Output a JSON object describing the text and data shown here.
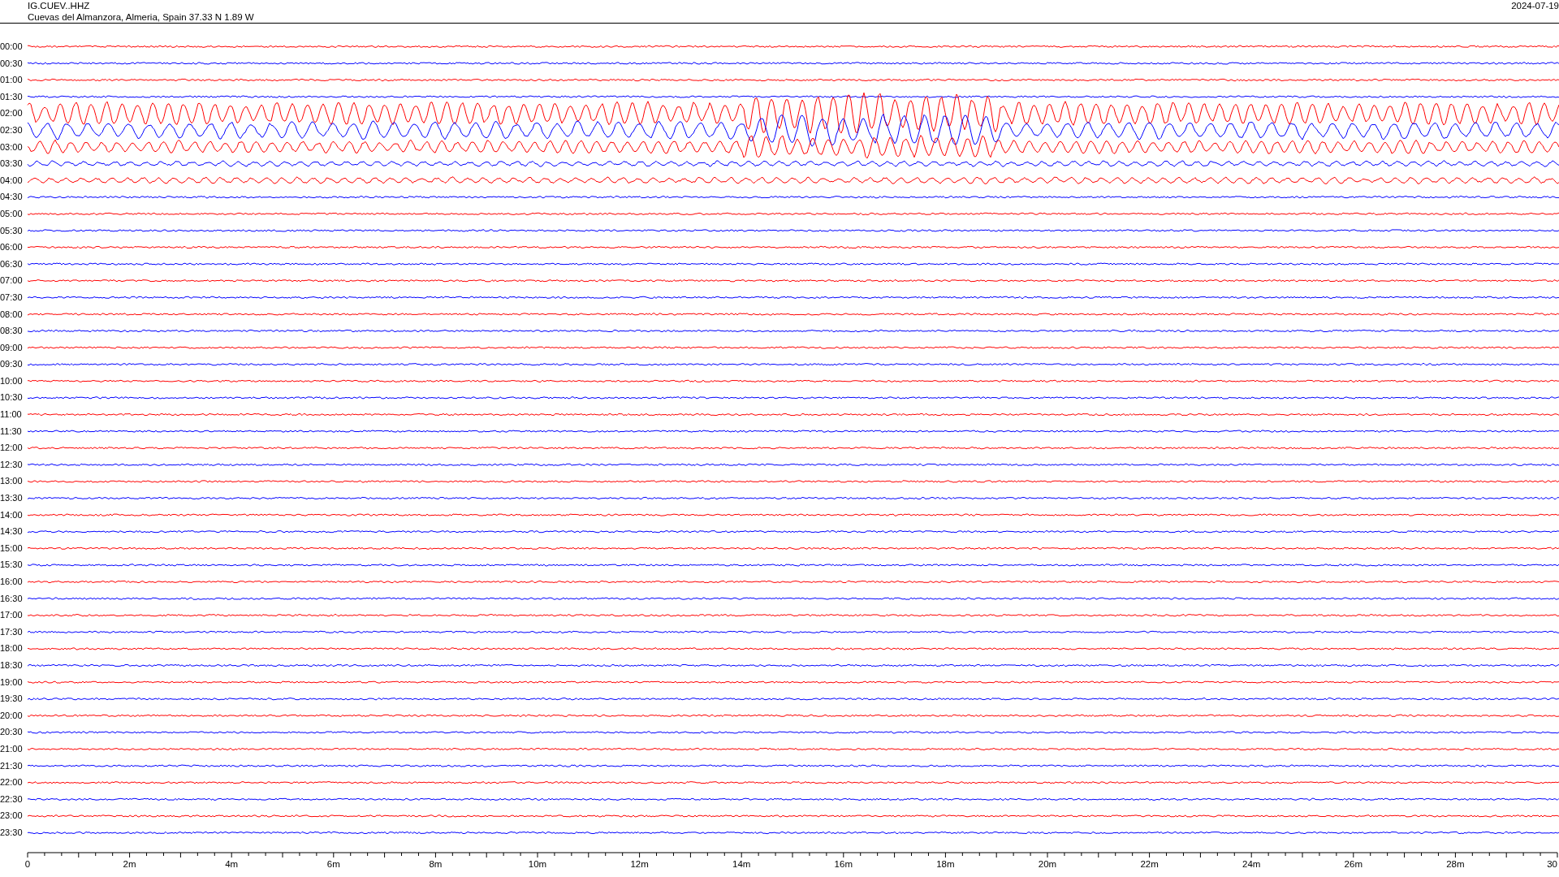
{
  "header": {
    "station": "IG.CUEV..HHZ",
    "location": "Cuevas del Almanzora, Almeria, Spain  37.33 N 1.89 W",
    "date": "2024-07-19"
  },
  "rows": [
    {
      "time": "00:00",
      "color": "#ff0000"
    },
    {
      "time": "00:30",
      "color": "#0000ff"
    },
    {
      "time": "01:00",
      "color": "#ff0000"
    },
    {
      "time": "01:30",
      "color": "#0000ff"
    },
    {
      "time": "02:00",
      "color": "#ff0000"
    },
    {
      "time": "02:30",
      "color": "#0000ff"
    },
    {
      "time": "03:00",
      "color": "#ff0000"
    },
    {
      "time": "03:30",
      "color": "#0000ff"
    },
    {
      "time": "04:00",
      "color": "#ff0000"
    },
    {
      "time": "04:30",
      "color": "#0000ff"
    },
    {
      "time": "05:00",
      "color": "#ff0000"
    },
    {
      "time": "05:30",
      "color": "#0000ff"
    },
    {
      "time": "06:00",
      "color": "#ff0000"
    },
    {
      "time": "06:30",
      "color": "#0000ff"
    },
    {
      "time": "07:00",
      "color": "#ff0000"
    },
    {
      "time": "07:30",
      "color": "#0000ff"
    },
    {
      "time": "08:00",
      "color": "#ff0000"
    },
    {
      "time": "08:30",
      "color": "#0000ff"
    },
    {
      "time": "09:00",
      "color": "#ff0000"
    },
    {
      "time": "09:30",
      "color": "#0000ff"
    },
    {
      "time": "10:00",
      "color": "#ff0000"
    },
    {
      "time": "10:30",
      "color": "#0000ff"
    },
    {
      "time": "11:00",
      "color": "#ff0000"
    },
    {
      "time": "11:30",
      "color": "#0000ff"
    },
    {
      "time": "12:00",
      "color": "#ff0000"
    },
    {
      "time": "12:30",
      "color": "#0000ff"
    },
    {
      "time": "13:00",
      "color": "#ff0000"
    },
    {
      "time": "13:30",
      "color": "#0000ff"
    },
    {
      "time": "14:00",
      "color": "#ff0000"
    },
    {
      "time": "14:30",
      "color": "#0000ff"
    },
    {
      "time": "15:00",
      "color": "#ff0000"
    },
    {
      "time": "15:30",
      "color": "#0000ff"
    },
    {
      "time": "16:00",
      "color": "#ff0000"
    },
    {
      "time": "16:30",
      "color": "#0000ff"
    },
    {
      "time": "17:00",
      "color": "#ff0000"
    },
    {
      "time": "17:30",
      "color": "#0000ff"
    },
    {
      "time": "18:00",
      "color": "#ff0000"
    },
    {
      "time": "18:30",
      "color": "#0000ff"
    },
    {
      "time": "19:00",
      "color": "#ff0000"
    },
    {
      "time": "19:30",
      "color": "#0000ff"
    },
    {
      "time": "20:00",
      "color": "#ff0000"
    },
    {
      "time": "20:30",
      "color": "#0000ff"
    },
    {
      "time": "21:00",
      "color": "#ff0000"
    },
    {
      "time": "21:30",
      "color": "#0000ff"
    },
    {
      "time": "22:00",
      "color": "#ff0000"
    },
    {
      "time": "22:30",
      "color": "#0000ff"
    },
    {
      "time": "23:00",
      "color": "#ff0000"
    },
    {
      "time": "23:30",
      "color": "#0000ff"
    }
  ],
  "x_axis": {
    "labels": [
      "0",
      "2m",
      "4m",
      "6m",
      "8m",
      "10m",
      "12m",
      "14m",
      "16m",
      "18m",
      "20m",
      "22m",
      "24m",
      "26m",
      "28m",
      "30"
    ]
  }
}
